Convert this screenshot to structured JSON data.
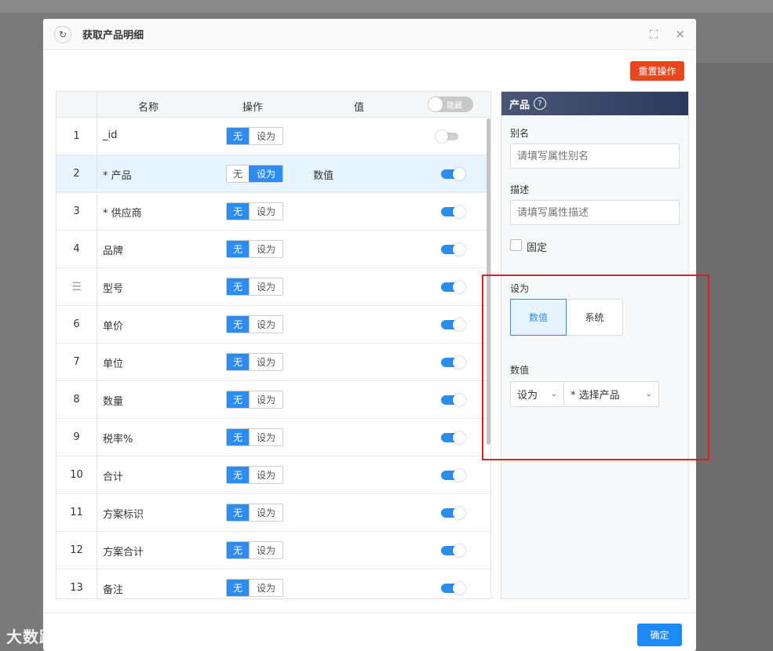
{
  "modal": {
    "title": "获取产品明细",
    "reset_label": "重置操作",
    "ok_label": "确定"
  },
  "table": {
    "headers": {
      "name": "名称",
      "operation": "操作",
      "value": "值",
      "hide_toggle_label": "隐藏"
    },
    "seg_labels": {
      "none": "无",
      "set": "设为"
    },
    "rows": [
      {
        "index": "1",
        "name": "_id",
        "mode": "none",
        "value": "",
        "enabled": false
      },
      {
        "index": "2",
        "name": "* 产品",
        "mode": "set",
        "value": "数值",
        "enabled": true,
        "selected": true
      },
      {
        "index": "3",
        "name": "* 供应商",
        "mode": "none",
        "value": "",
        "enabled": true
      },
      {
        "index": "4",
        "name": "品牌",
        "mode": "none",
        "value": "",
        "enabled": true
      },
      {
        "index": "",
        "name": "型号",
        "mode": "none",
        "value": "",
        "enabled": true,
        "drag": true
      },
      {
        "index": "6",
        "name": "单价",
        "mode": "none",
        "value": "",
        "enabled": true
      },
      {
        "index": "7",
        "name": "单位",
        "mode": "none",
        "value": "",
        "enabled": true
      },
      {
        "index": "8",
        "name": "数量",
        "mode": "none",
        "value": "",
        "enabled": true
      },
      {
        "index": "9",
        "name": "税率%",
        "mode": "none",
        "value": "",
        "enabled": true
      },
      {
        "index": "10",
        "name": "合计",
        "mode": "none",
        "value": "",
        "enabled": true
      },
      {
        "index": "11",
        "name": "方案标识",
        "mode": "none",
        "value": "",
        "enabled": true
      },
      {
        "index": "12",
        "name": "方案合计",
        "mode": "none",
        "value": "",
        "enabled": true
      },
      {
        "index": "13",
        "name": "备注",
        "mode": "none",
        "value": "",
        "enabled": true
      }
    ]
  },
  "panel": {
    "title": "产品",
    "alias_label": "别名",
    "alias_placeholder": "请填写属性别名",
    "desc_label": "描述",
    "desc_placeholder": "请填写属性描述",
    "fixed_label": "固定",
    "set_as_label": "设为",
    "set_as_options": [
      "数值",
      "系统"
    ],
    "set_as_selected": "数值",
    "value_label": "数值",
    "value_op": "设为",
    "value_target": "* 选择产品"
  },
  "watermark": "大数跨境",
  "colors": {
    "primary": "#2d8cf0",
    "danger": "#e8461c",
    "highlight_box": "#e02020"
  }
}
